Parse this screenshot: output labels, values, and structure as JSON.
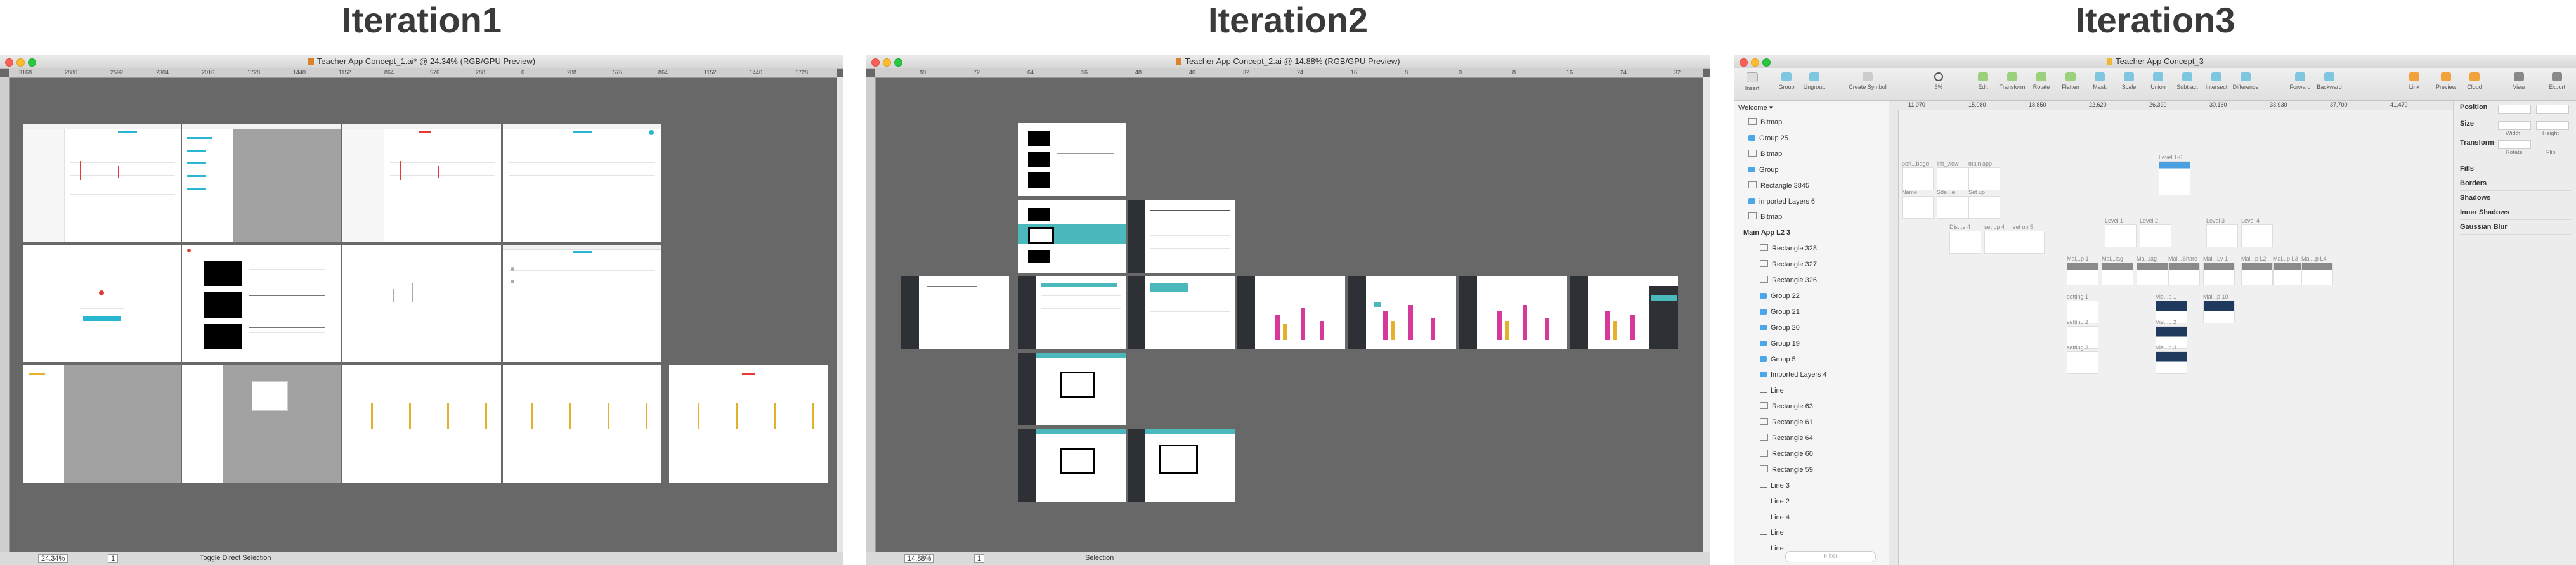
{
  "headings": [
    "Iteration1",
    "Iteration2",
    "Iteration3"
  ],
  "iteration1": {
    "window_title": "Teacher App Concept_1.ai* @ 24.34% (RGB/GPU Preview)",
    "ruler_ticks": [
      "3168",
      "2880",
      "2592",
      "2304",
      "2016",
      "1728",
      "1440",
      "1152",
      "864",
      "576",
      "288",
      "0",
      "288",
      "576",
      "864",
      "1152",
      "1440",
      "1728"
    ],
    "zoom": "24.34%",
    "page": "1",
    "status": "Toggle Direct Selection"
  },
  "iteration2": {
    "window_title": "Teacher App Concept_2.ai @ 14.88% (RGB/GPU Preview)",
    "ruler_ticks": [
      "80",
      "72",
      "64",
      "56",
      "48",
      "40",
      "32",
      "24",
      "16",
      "8",
      "0",
      "8",
      "16",
      "24",
      "32"
    ],
    "zoom": "14.88%",
    "page": "1",
    "status": "Selection"
  },
  "iteration3": {
    "window_title": "Teacher App Concept_3",
    "toolbar_left": [
      "Insert",
      "Group",
      "Ungroup",
      "Create Symbol"
    ],
    "zoom": "5%",
    "toolbar_mid": [
      "Edit",
      "Transform",
      "Rotate",
      "Flatten",
      "Mask",
      "Scale",
      "Union",
      "Subtract",
      "Intersect",
      "Difference"
    ],
    "toolbar_right": [
      "Forward",
      "Backward",
      "Link",
      "Preview",
      "Cloud",
      "View",
      "Export"
    ],
    "page_select": "Welcome",
    "ruler_ticks": [
      "11,070",
      "15,080",
      "18,850",
      "22,620",
      "26,390",
      "30,160",
      "33,930",
      "37,700",
      "41,470"
    ],
    "layers": [
      {
        "name": "Bitmap",
        "type": "shape",
        "indent": 0
      },
      {
        "name": "Group 25",
        "type": "folder",
        "indent": 0
      },
      {
        "name": "Bitmap",
        "type": "shape",
        "indent": 0
      },
      {
        "name": "Group",
        "type": "folder",
        "indent": 0
      },
      {
        "name": "Rectangle 3845",
        "type": "shape",
        "indent": 0
      },
      {
        "name": "imported Layers 6",
        "type": "folder",
        "indent": 0
      },
      {
        "name": "Bitmap",
        "type": "shape",
        "indent": 0
      },
      {
        "name": "Main App L2 3",
        "type": "artboard",
        "indent": 0
      },
      {
        "name": "Rectangle 328",
        "type": "shape",
        "indent": 1
      },
      {
        "name": "Rectangle 327",
        "type": "shape",
        "indent": 1
      },
      {
        "name": "Rectangle 326",
        "type": "shape",
        "indent": 1
      },
      {
        "name": "Group 22",
        "type": "folder",
        "indent": 1
      },
      {
        "name": "Group 21",
        "type": "folder",
        "indent": 1
      },
      {
        "name": "Group 20",
        "type": "folder",
        "indent": 1
      },
      {
        "name": "Group 19",
        "type": "folder",
        "indent": 1
      },
      {
        "name": "Group 5",
        "type": "folder",
        "indent": 1
      },
      {
        "name": "Imported Layers 4",
        "type": "folder",
        "indent": 1
      },
      {
        "name": "Line",
        "type": "line",
        "indent": 1
      },
      {
        "name": "Rectangle 63",
        "type": "shape",
        "indent": 1
      },
      {
        "name": "Rectangle 61",
        "type": "shape",
        "indent": 1
      },
      {
        "name": "Rectangle 64",
        "type": "shape",
        "indent": 1
      },
      {
        "name": "Rectangle 60",
        "type": "shape",
        "indent": 1
      },
      {
        "name": "Rectangle 59",
        "type": "shape",
        "indent": 1
      },
      {
        "name": "Line 3",
        "type": "line",
        "indent": 1
      },
      {
        "name": "Line 2",
        "type": "line",
        "indent": 1
      },
      {
        "name": "Line 4",
        "type": "line",
        "indent": 1
      },
      {
        "name": "Line",
        "type": "line",
        "indent": 1
      },
      {
        "name": "Line",
        "type": "line",
        "indent": 1
      }
    ],
    "filter_placeholder": "Filter",
    "inspector": {
      "position": "Position",
      "size": "Size",
      "width": "Width",
      "height": "Height",
      "transform": "Transform",
      "rotate": "Rotate",
      "flip": "Flip",
      "sections": [
        "Fills",
        "Borders",
        "Shadows",
        "Inner Shadows",
        "Gaussian Blur"
      ]
    },
    "artboard_labels": [
      "pen...bage",
      "init_view",
      "main app",
      "Name",
      "Sde...e",
      "Set up",
      "Level 1-6",
      "Dis...e 4",
      "set up 4",
      "set up 5",
      "Level 1",
      "Level 2",
      "Level 3",
      "Level 4",
      "Mai...p 1",
      "Mai...lag",
      "Ma...lag",
      "Mai...Share",
      "Mai...Lv 1",
      "Mai...p L2",
      "Mai...p L3",
      "Mai...p L4",
      "setting 1",
      "setting 2",
      "setting 3",
      "Vie...p 1",
      "Vie...p 2",
      "Vie...p 3",
      "Mai...p 10"
    ]
  }
}
